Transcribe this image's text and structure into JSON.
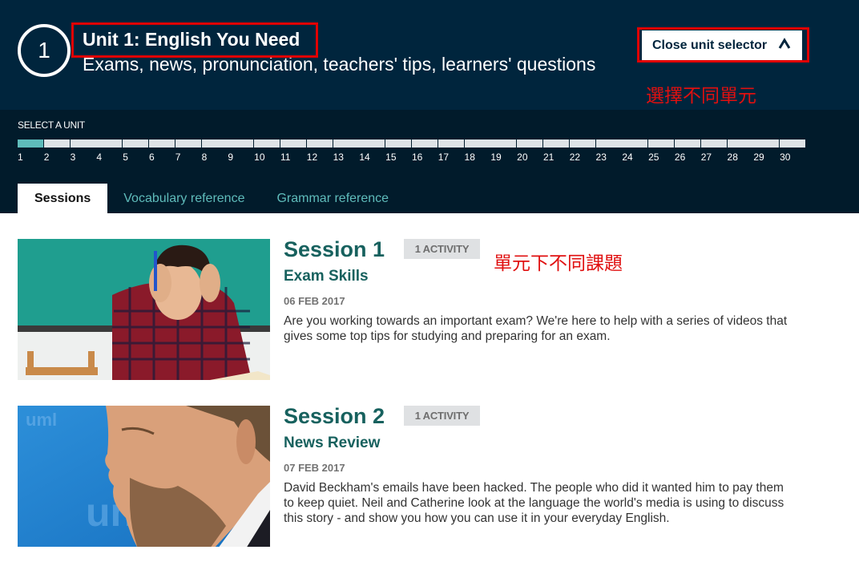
{
  "header": {
    "unit_number": "1",
    "unit_title": "Unit 1: English You Need",
    "unit_subtitle": "Exams, news, pronunciation, teachers' tips, learners' questions",
    "close_button_label": "Close unit selector",
    "close_button_icon": "chevron-up-icon"
  },
  "annotations": {
    "select_unit_note": "選擇不同單元",
    "session_note": "單元下不同課題",
    "highlight_color": "#e00000"
  },
  "selector": {
    "label": "SELECT A UNIT",
    "active_unit": 1,
    "active_color": "#5fbcbb",
    "units": [
      "1",
      "2",
      "3",
      "4",
      "5",
      "6",
      "7",
      "8",
      "9",
      "10",
      "11",
      "12",
      "13",
      "14",
      "15",
      "16",
      "17",
      "18",
      "19",
      "20",
      "21",
      "22",
      "23",
      "24",
      "25",
      "26",
      "27",
      "28",
      "29",
      "30"
    ]
  },
  "tabs": [
    {
      "label": "Sessions",
      "active": true
    },
    {
      "label": "Vocabulary reference",
      "active": false
    },
    {
      "label": "Grammar reference",
      "active": false
    }
  ],
  "sessions": [
    {
      "title": "Session 1",
      "badge": "1 ACTIVITY",
      "subtitle": "Exam Skills",
      "date": "06 FEB 2017",
      "description": "Are you working towards an important exam? We're here to help with a series of videos that gives some top tips for studying and preparing for an exam.",
      "image": "stressed-student-photo"
    },
    {
      "title": "Session 2",
      "badge": "1 ACTIVITY",
      "subtitle": "News Review",
      "date": "07 FEB 2017",
      "description": "David Beckham's emails have been hacked. The people who did it wanted him to pay them to keep quiet. Neil and Catherine look at the language the world's media is using to discuss this story - and show you how you can use it in your everyday English.",
      "image": "beckham-profile-photo"
    }
  ],
  "colors": {
    "header_bg": "#00253d",
    "selector_bg": "#011b2b",
    "session_title": "#17615e",
    "tab_inactive": "#5fbcbb"
  }
}
